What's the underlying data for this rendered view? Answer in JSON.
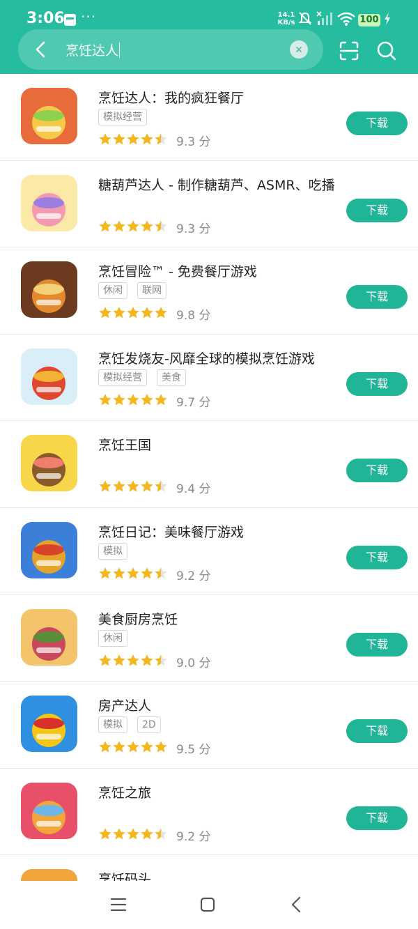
{
  "status_bar": {
    "time": "3:06",
    "more": "···",
    "net_speed": "14.1",
    "net_unit": "KB/s",
    "battery": "100"
  },
  "search": {
    "query": "烹饪达人"
  },
  "download_label": "下载",
  "apps": [
    {
      "name": "烹饪达人：我的疯狂餐厅",
      "tags": [
        "模拟经营"
      ],
      "score": "9.3 分",
      "stars": 4.5
    },
    {
      "name": "糖葫芦达人 - 制作糖葫芦、ASMR、吃播",
      "tags": [],
      "score": "9.3 分",
      "stars": 4.5
    },
    {
      "name": "烹饪冒险™ - 免费餐厅游戏",
      "tags": [
        "休闲",
        "联网"
      ],
      "score": "9.8 分",
      "stars": 5
    },
    {
      "name": "烹饪发烧友-风靡全球的模拟烹饪游戏",
      "tags": [
        "模拟经营",
        "美食"
      ],
      "score": "9.7 分",
      "stars": 5
    },
    {
      "name": "烹饪王国",
      "tags": [],
      "score": "9.4 分",
      "stars": 4.5
    },
    {
      "name": "烹饪日记：美味餐厅游戏",
      "tags": [
        "模拟"
      ],
      "score": "9.2 分",
      "stars": 4.5
    },
    {
      "name": "美食厨房烹饪",
      "tags": [
        "休闲"
      ],
      "score": "9.0 分",
      "stars": 4.5
    },
    {
      "name": "房产达人",
      "tags": [
        "模拟",
        "2D"
      ],
      "score": "9.5 分",
      "stars": 5
    },
    {
      "name": "烹饪之旅",
      "tags": [],
      "score": "9.2 分",
      "stars": 4.5
    },
    {
      "name": "烹饪码头",
      "tags": [],
      "score": "",
      "stars": 0
    }
  ],
  "icons": {
    "back": "chevron-left-icon",
    "clear": "clear-icon",
    "scan": "scan-icon",
    "search": "search-icon",
    "nav_menu": "menu-icon",
    "nav_home": "home-icon",
    "nav_back": "back-icon"
  },
  "colors": {
    "header": "#25bc9f",
    "download_button": "#20b596",
    "star": "#f5b71e"
  }
}
